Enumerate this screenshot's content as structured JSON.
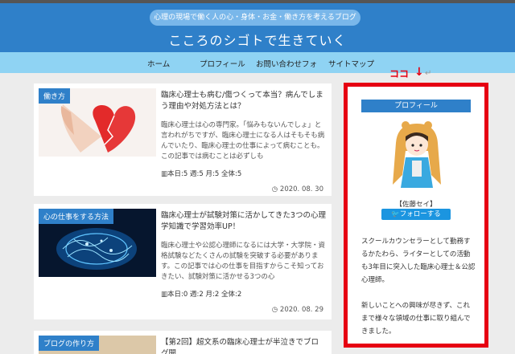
{
  "header": {
    "tagline": "心理の現場で働く人の心・身体・お金・働き方を考えるブログ",
    "site_title": "こころのシゴトで生きていく"
  },
  "nav": {
    "items": [
      {
        "label": "ホーム"
      },
      {
        "label": "プロフィール"
      },
      {
        "label": "お問い合わせフォ"
      },
      {
        "label": "サイトマップ"
      }
    ]
  },
  "articles": [
    {
      "category": "働き方",
      "title": "臨床心理士も病む/傷つくって本当？病んでしまう理由や対処方法とは？",
      "excerpt": "臨床心理士は心の専門家。「悩みもないんでしょ」と言われがちですが、臨床心理士になる人はそもそも病んでいたり、臨床心理士の仕事によって病むことも。この記事では病むことは必ずしも",
      "stats": "本日:5 週:5 月:5 全体:5",
      "date": "2020. 08. 30"
    },
    {
      "category": "心の仕事をする方法",
      "title": "臨床心理士が試験対策に活かしてきた3つの心理学知識で学習効率UP！",
      "excerpt": "臨床心理士や公認心理師になるには大学・大学院・資格試験などたくさんの試験を突破する必要があります。この記事では心の仕事を目指すからこそ知っておきたい、試験対策に活かせる3つの心",
      "stats": "本日:0 週:2 月:2 全体:2",
      "date": "2020. 08. 29"
    },
    {
      "category": "ブログの作り方",
      "title": "【第2回】超文系の臨床心理士が半泣きでブログ開"
    }
  ],
  "sidebar": {
    "heading": "プロフィール",
    "name": "【佐藤セイ】",
    "follow_label": "フォローする",
    "bio_1": "スクールカウンセラーとして勤務するかたわら、ライターとしての活動も3年目に突入した臨床心理士＆公認心理師。",
    "bio_2": "新しいことへの興味が尽きず、これまで様々な領域の仕事に取り組んできました。"
  },
  "annotation": {
    "label": "ココ",
    "arrow": "↓",
    "return_mark": "↵"
  },
  "colors": {
    "header_blue": "#2f80c9",
    "nav_cyan": "#8fd3f3",
    "highlight_red": "#e60012",
    "twitter_blue": "#1b95e0"
  }
}
